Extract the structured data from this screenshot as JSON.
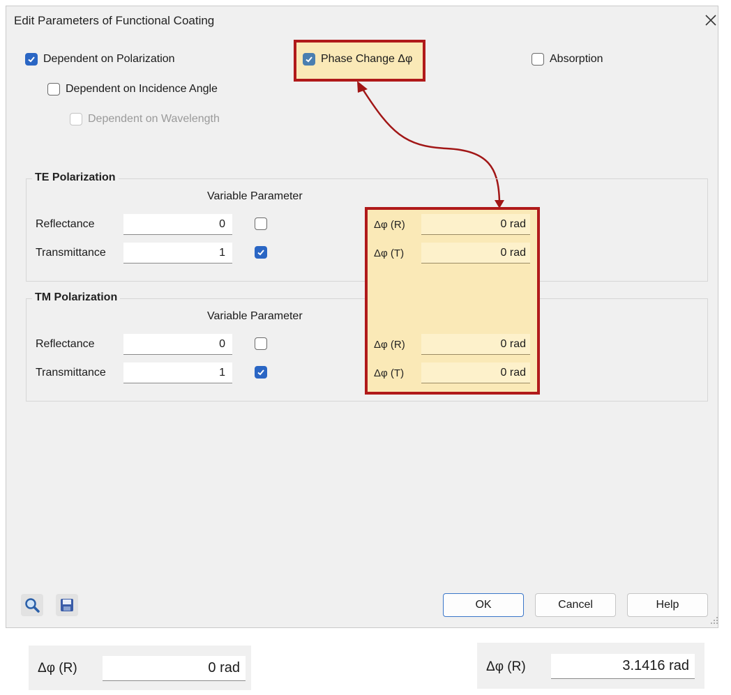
{
  "dialog": {
    "title": "Edit Parameters of Functional Coating",
    "close_glyph": "✕"
  },
  "options": {
    "polarization": {
      "label": "Dependent on Polarization",
      "checked": true
    },
    "incidence": {
      "label": "Dependent on Incidence Angle",
      "checked": false
    },
    "wavelength": {
      "label": "Dependent on Wavelength",
      "checked": false,
      "enabled": false
    },
    "phase_change": {
      "label": "Phase Change Δφ",
      "checked": true
    },
    "absorption": {
      "label": "Absorption",
      "checked": false
    }
  },
  "te": {
    "title": "TE Polarization",
    "variable_header": "Variable Parameter",
    "reflectance_label": "Reflectance",
    "reflectance_value": "0",
    "reflectance_variable": false,
    "transmittance_label": "Transmittance",
    "transmittance_value": "1",
    "transmittance_variable": true,
    "dphi_r_label": "Δφ (R)",
    "dphi_r_value": "0 rad",
    "dphi_t_label": "Δφ (T)",
    "dphi_t_value": "0 rad"
  },
  "tm": {
    "title": "TM Polarization",
    "variable_header": "Variable Parameter",
    "reflectance_label": "Reflectance",
    "reflectance_value": "0",
    "reflectance_variable": false,
    "transmittance_label": "Transmittance",
    "transmittance_value": "1",
    "transmittance_variable": true,
    "dphi_r_label": "Δφ (R)",
    "dphi_r_value": "0 rad",
    "dphi_t_label": "Δφ (T)",
    "dphi_t_value": "0 rad"
  },
  "buttons": {
    "ok": "OK",
    "cancel": "Cancel",
    "help": "Help"
  },
  "bottom": {
    "left_label": "Δφ (R)",
    "left_value": "0 rad",
    "right_label": "Δφ (R)",
    "right_value": "3.1416 rad"
  },
  "colors": {
    "highlight_border": "#b01a1a",
    "highlight_fill": "#fae9b7",
    "checkbox_accent": "#2a66c4"
  },
  "icons": [
    "close-icon",
    "check-icon",
    "search-icon",
    "save-icon",
    "resize-grip-icon"
  ]
}
